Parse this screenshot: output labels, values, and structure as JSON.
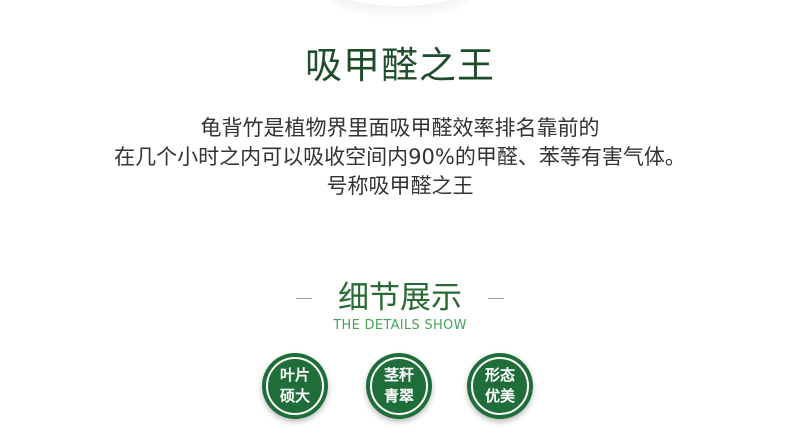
{
  "title": "吸甲醛之王",
  "description": {
    "line1": "龟背竹是植物界里面吸甲醛效率排名靠前的",
    "line2": "在几个小时之内可以吸收空间内90%的甲醛、苯等有害气体。",
    "line3": "号称吸甲醛之王"
  },
  "section": {
    "title": "细节展示",
    "subtitle": "THE DETAILS SHOW"
  },
  "badges": [
    {
      "line1": "叶片",
      "line2": "硕大"
    },
    {
      "line1": "茎秆",
      "line2": "青翠"
    },
    {
      "line1": "形态",
      "line2": "优美"
    }
  ],
  "colors": {
    "title": "#1f4d2b",
    "section_title": "#2a6a34",
    "section_subtitle": "#46a35a",
    "badge": "#1f6e3a"
  }
}
